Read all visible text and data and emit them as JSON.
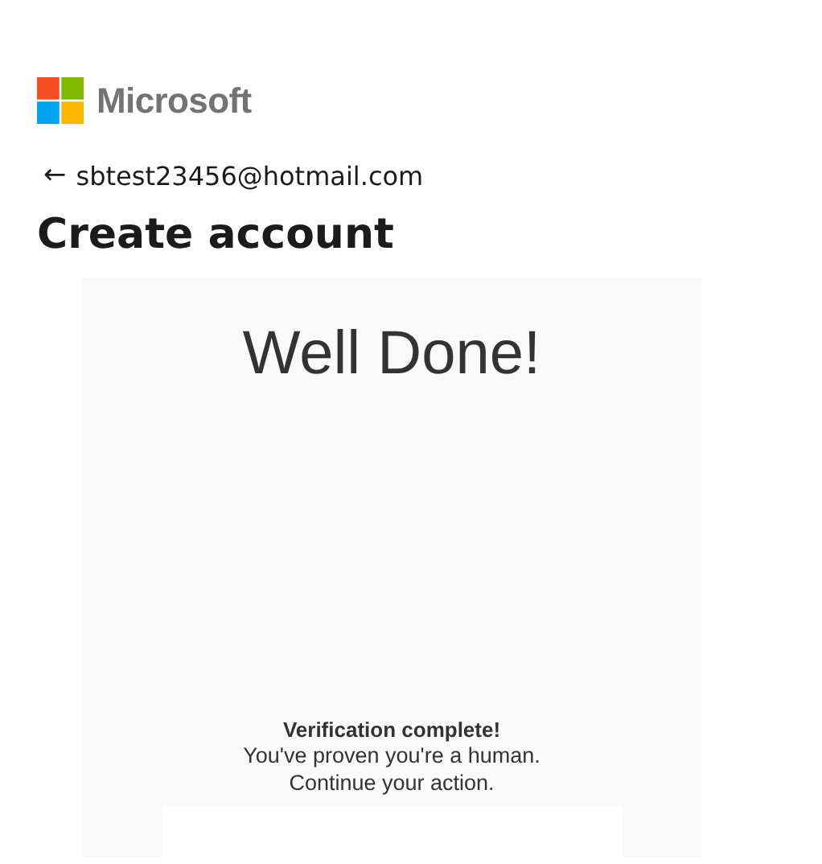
{
  "brand": {
    "name": "Microsoft"
  },
  "identity": {
    "back": "←",
    "email": "sbtest23456@hotmail.com"
  },
  "heading": "Create account",
  "challenge": {
    "title": "Well Done!",
    "status": "Verification complete!",
    "lines": [
      "You've proven you're a human.",
      "Continue your action."
    ]
  }
}
